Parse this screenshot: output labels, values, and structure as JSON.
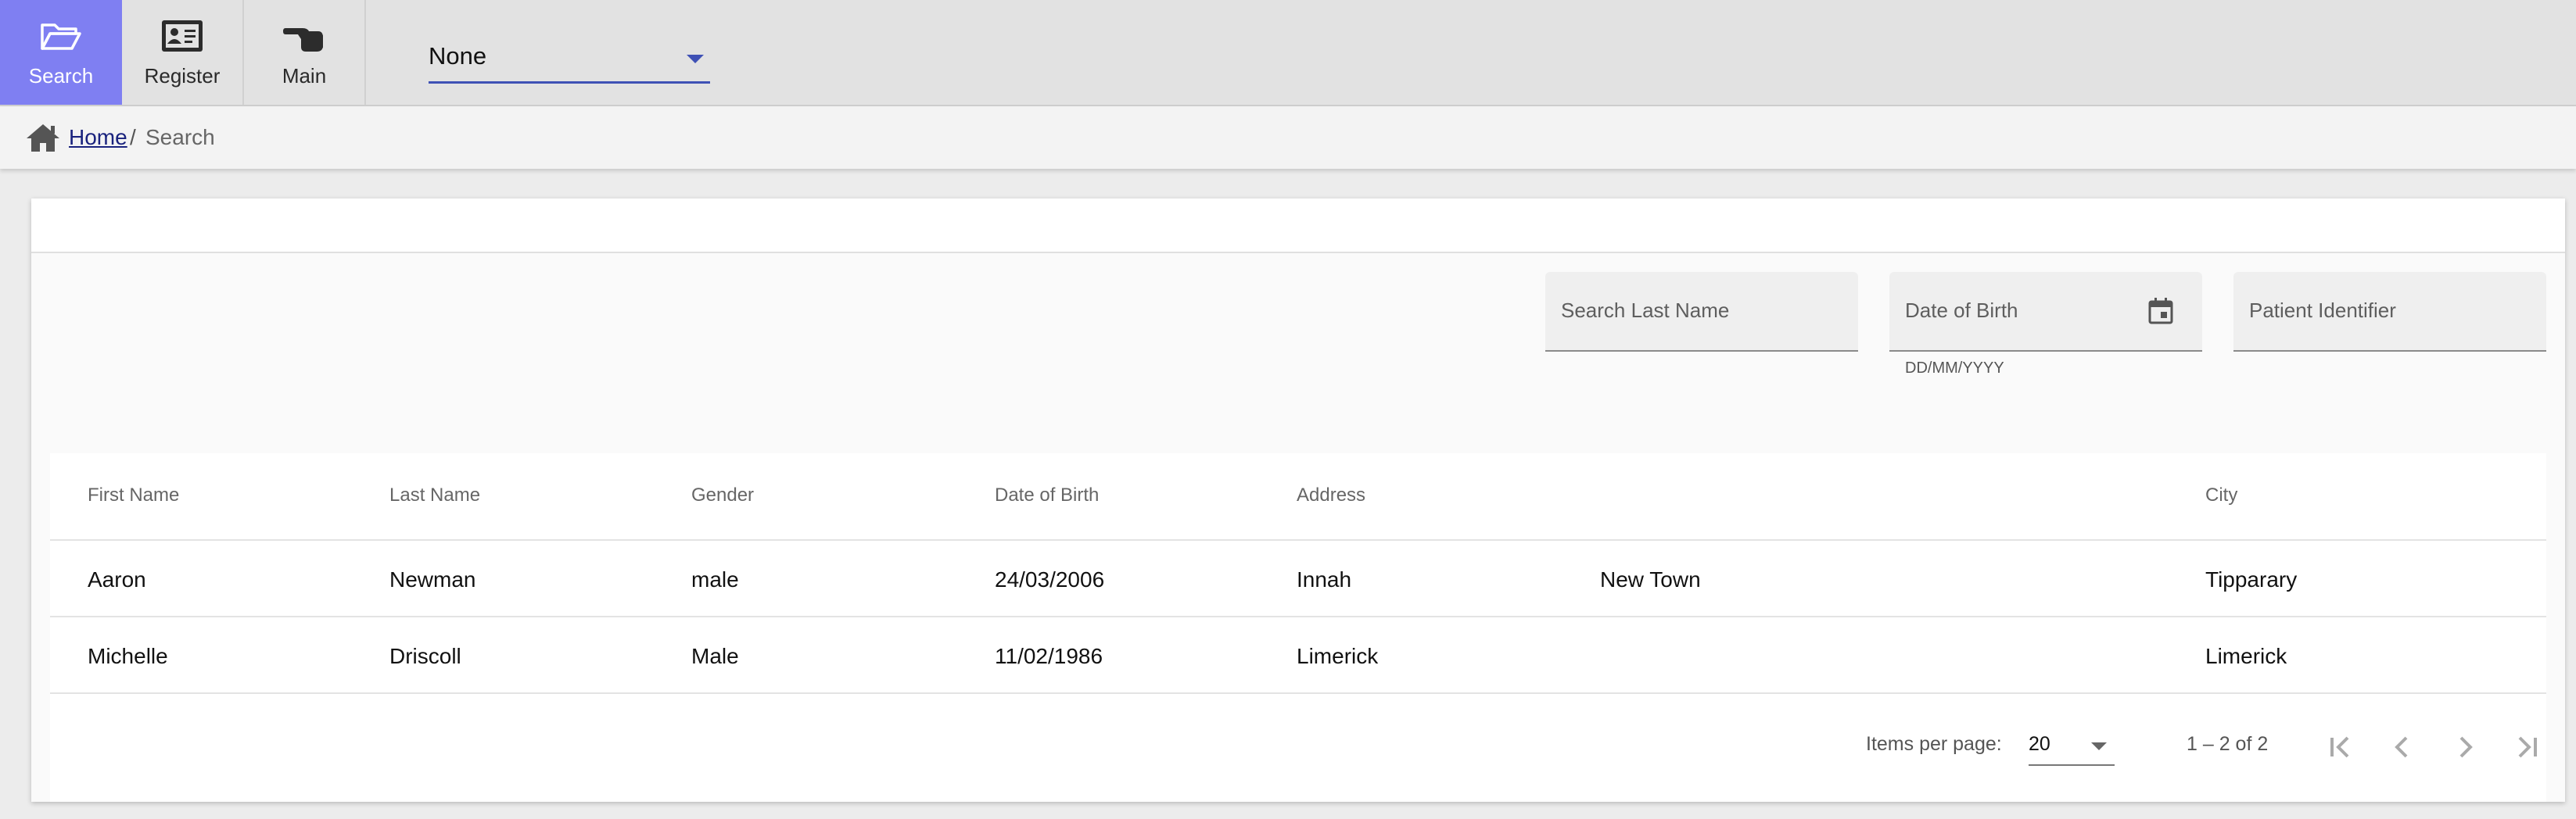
{
  "toolbar": {
    "search_label": "Search",
    "register_label": "Register",
    "main_label": "Main",
    "select_value": "None",
    "active_color": "#7f7ff2",
    "accent_color": "#3f51b5"
  },
  "breadcrumb": {
    "home": "Home",
    "separator": "/",
    "current": "Search"
  },
  "filters": {
    "last_name_placeholder": "Search Last Name",
    "dob_placeholder": "Date of Birth",
    "dob_hint": "DD/MM/YYYY",
    "identifier_placeholder": "Patient Identifier"
  },
  "table": {
    "columns": [
      "First Name",
      "Last Name",
      "Gender",
      "Date of Birth",
      "Address",
      "",
      "City"
    ],
    "rows": [
      [
        "Aaron",
        "Newman",
        "male",
        "24/03/2006",
        "Innah",
        "New Town",
        "Tipparary"
      ],
      [
        "Michelle",
        "Driscoll",
        "Male",
        "11/02/1986",
        "Limerick",
        "",
        "Limerick"
      ]
    ]
  },
  "paginator": {
    "items_per_page_label": "Items per page:",
    "page_size": "20",
    "range_label": "1 – 2 of 2"
  },
  "icons": {
    "search": "folder-open-icon",
    "register": "id-card-icon",
    "main": "pointing-hand-icon",
    "home": "home-icon",
    "calendar": "calendar-icon"
  }
}
